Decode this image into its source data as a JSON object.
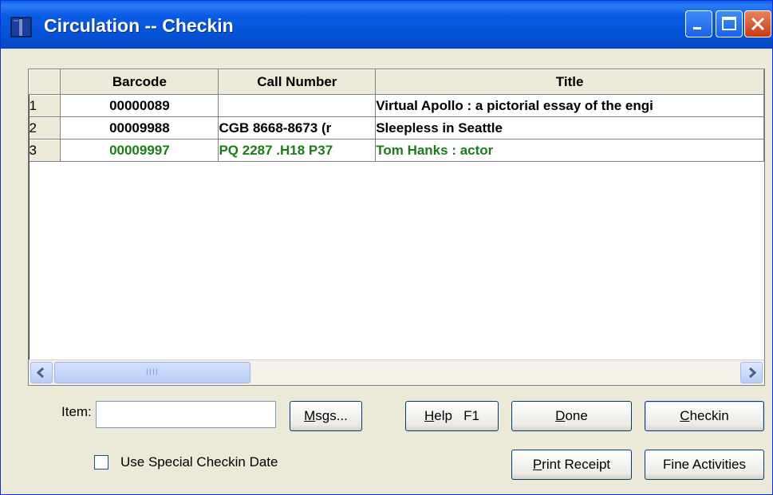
{
  "window": {
    "title": "Circulation -- Checkin",
    "controls": {
      "minimize": "minimize",
      "maximize": "maximize",
      "close": "close"
    }
  },
  "grid": {
    "columns": [
      "Barcode",
      "Call Number",
      "Title"
    ],
    "rows": [
      {
        "num": "1",
        "barcode": "00000089",
        "call_number": "",
        "title": "Virtual Apollo : a pictorial essay of the engi",
        "color": "#000000"
      },
      {
        "num": "2",
        "barcode": "00009988",
        "call_number": "CGB 8668-8673 (r",
        "title": "Sleepless in Seattle",
        "color": "#000000"
      },
      {
        "num": "3",
        "barcode": "00009997",
        "call_number": "PQ 2287 .H18 P37",
        "title": "Tom Hanks : actor",
        "color": "#1a7d16"
      }
    ],
    "scroll_thumb_grip": "IIII"
  },
  "form": {
    "item_label": "Item:",
    "item_value": "",
    "special_date_label": "Use Special Checkin Date",
    "special_date_checked": false
  },
  "buttons": {
    "msgs": {
      "mnemonic": "M",
      "rest": "sgs..."
    },
    "help": {
      "mnemonic": "H",
      "rest": "elp   F1"
    },
    "done": {
      "mnemonic": "D",
      "rest": "one"
    },
    "checkin": {
      "mnemonic": "C",
      "rest": "heckin"
    },
    "print_receipt": {
      "mnemonic": "P",
      "rest": "rint Receipt"
    },
    "fine_activities": {
      "label": "Fine Activities"
    }
  },
  "colors": {
    "titlebar": "#0a5ce6",
    "highlight_row": "#1a7d16",
    "face": "#ece9d8"
  }
}
